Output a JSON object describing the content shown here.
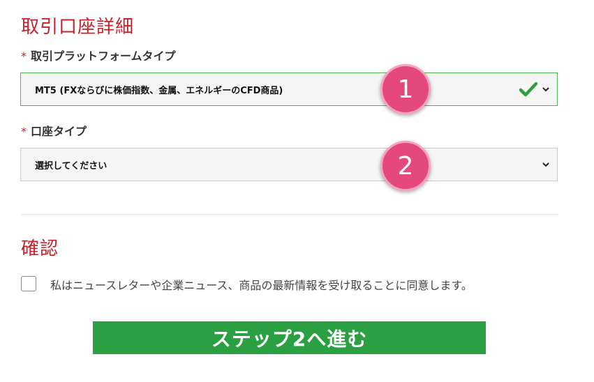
{
  "account_details": {
    "title": "取引口座詳細",
    "platform": {
      "required_mark": "*",
      "label": "取引プラットフォームタイプ",
      "selected": "MT5 (FXならびに株価指数、金属、エネルギーのCFD商品)",
      "badge": "1"
    },
    "account_type": {
      "required_mark": "*",
      "label": "口座タイプ",
      "selected": "選択してください",
      "badge": "2"
    }
  },
  "confirmation": {
    "title": "確認",
    "consent_text": "私はニュースレターや企業ニュース、商品の最新情報を受け取ることに同意します。"
  },
  "submit_label": "ステップ2へ進む",
  "colors": {
    "accent_red": "#c8202a",
    "valid_green": "#4caf50",
    "button_green": "#2aa043",
    "badge_pink": "#e5487d"
  }
}
